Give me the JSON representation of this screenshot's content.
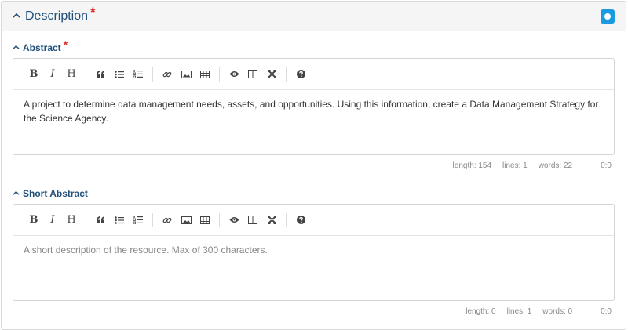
{
  "panel": {
    "title": "Description",
    "required_mark": "*"
  },
  "abstract": {
    "label": "Abstract",
    "required_mark": "*",
    "content": "A project to determine data management needs, assets, and opportunities. Using this information, create a Data Management Strategy for the Science Agency.",
    "status": {
      "length": "length: 154",
      "lines": "lines: 1",
      "words": "words: 22",
      "cursor": "0:0"
    }
  },
  "short_abstract": {
    "label": "Short Abstract",
    "placeholder": "A short description of the resource. Max of 300 characters.",
    "status": {
      "length": "length: 0",
      "lines": "lines: 1",
      "words": "words: 0",
      "cursor": "0:0"
    }
  },
  "toolbar": {
    "bold": "B",
    "italic": "I",
    "heading": "H",
    "quote": "❝",
    "icons": [
      "bold-icon",
      "italic-icon",
      "heading-icon",
      "quote-icon",
      "unordered-list-icon",
      "ordered-list-icon",
      "link-icon",
      "image-icon",
      "table-icon",
      "preview-icon",
      "side-by-side-icon",
      "fullscreen-icon",
      "help-icon"
    ]
  },
  "colors": {
    "accent": "#1a9ae0",
    "title": "#1f4f7a",
    "required": "#d9302c"
  }
}
